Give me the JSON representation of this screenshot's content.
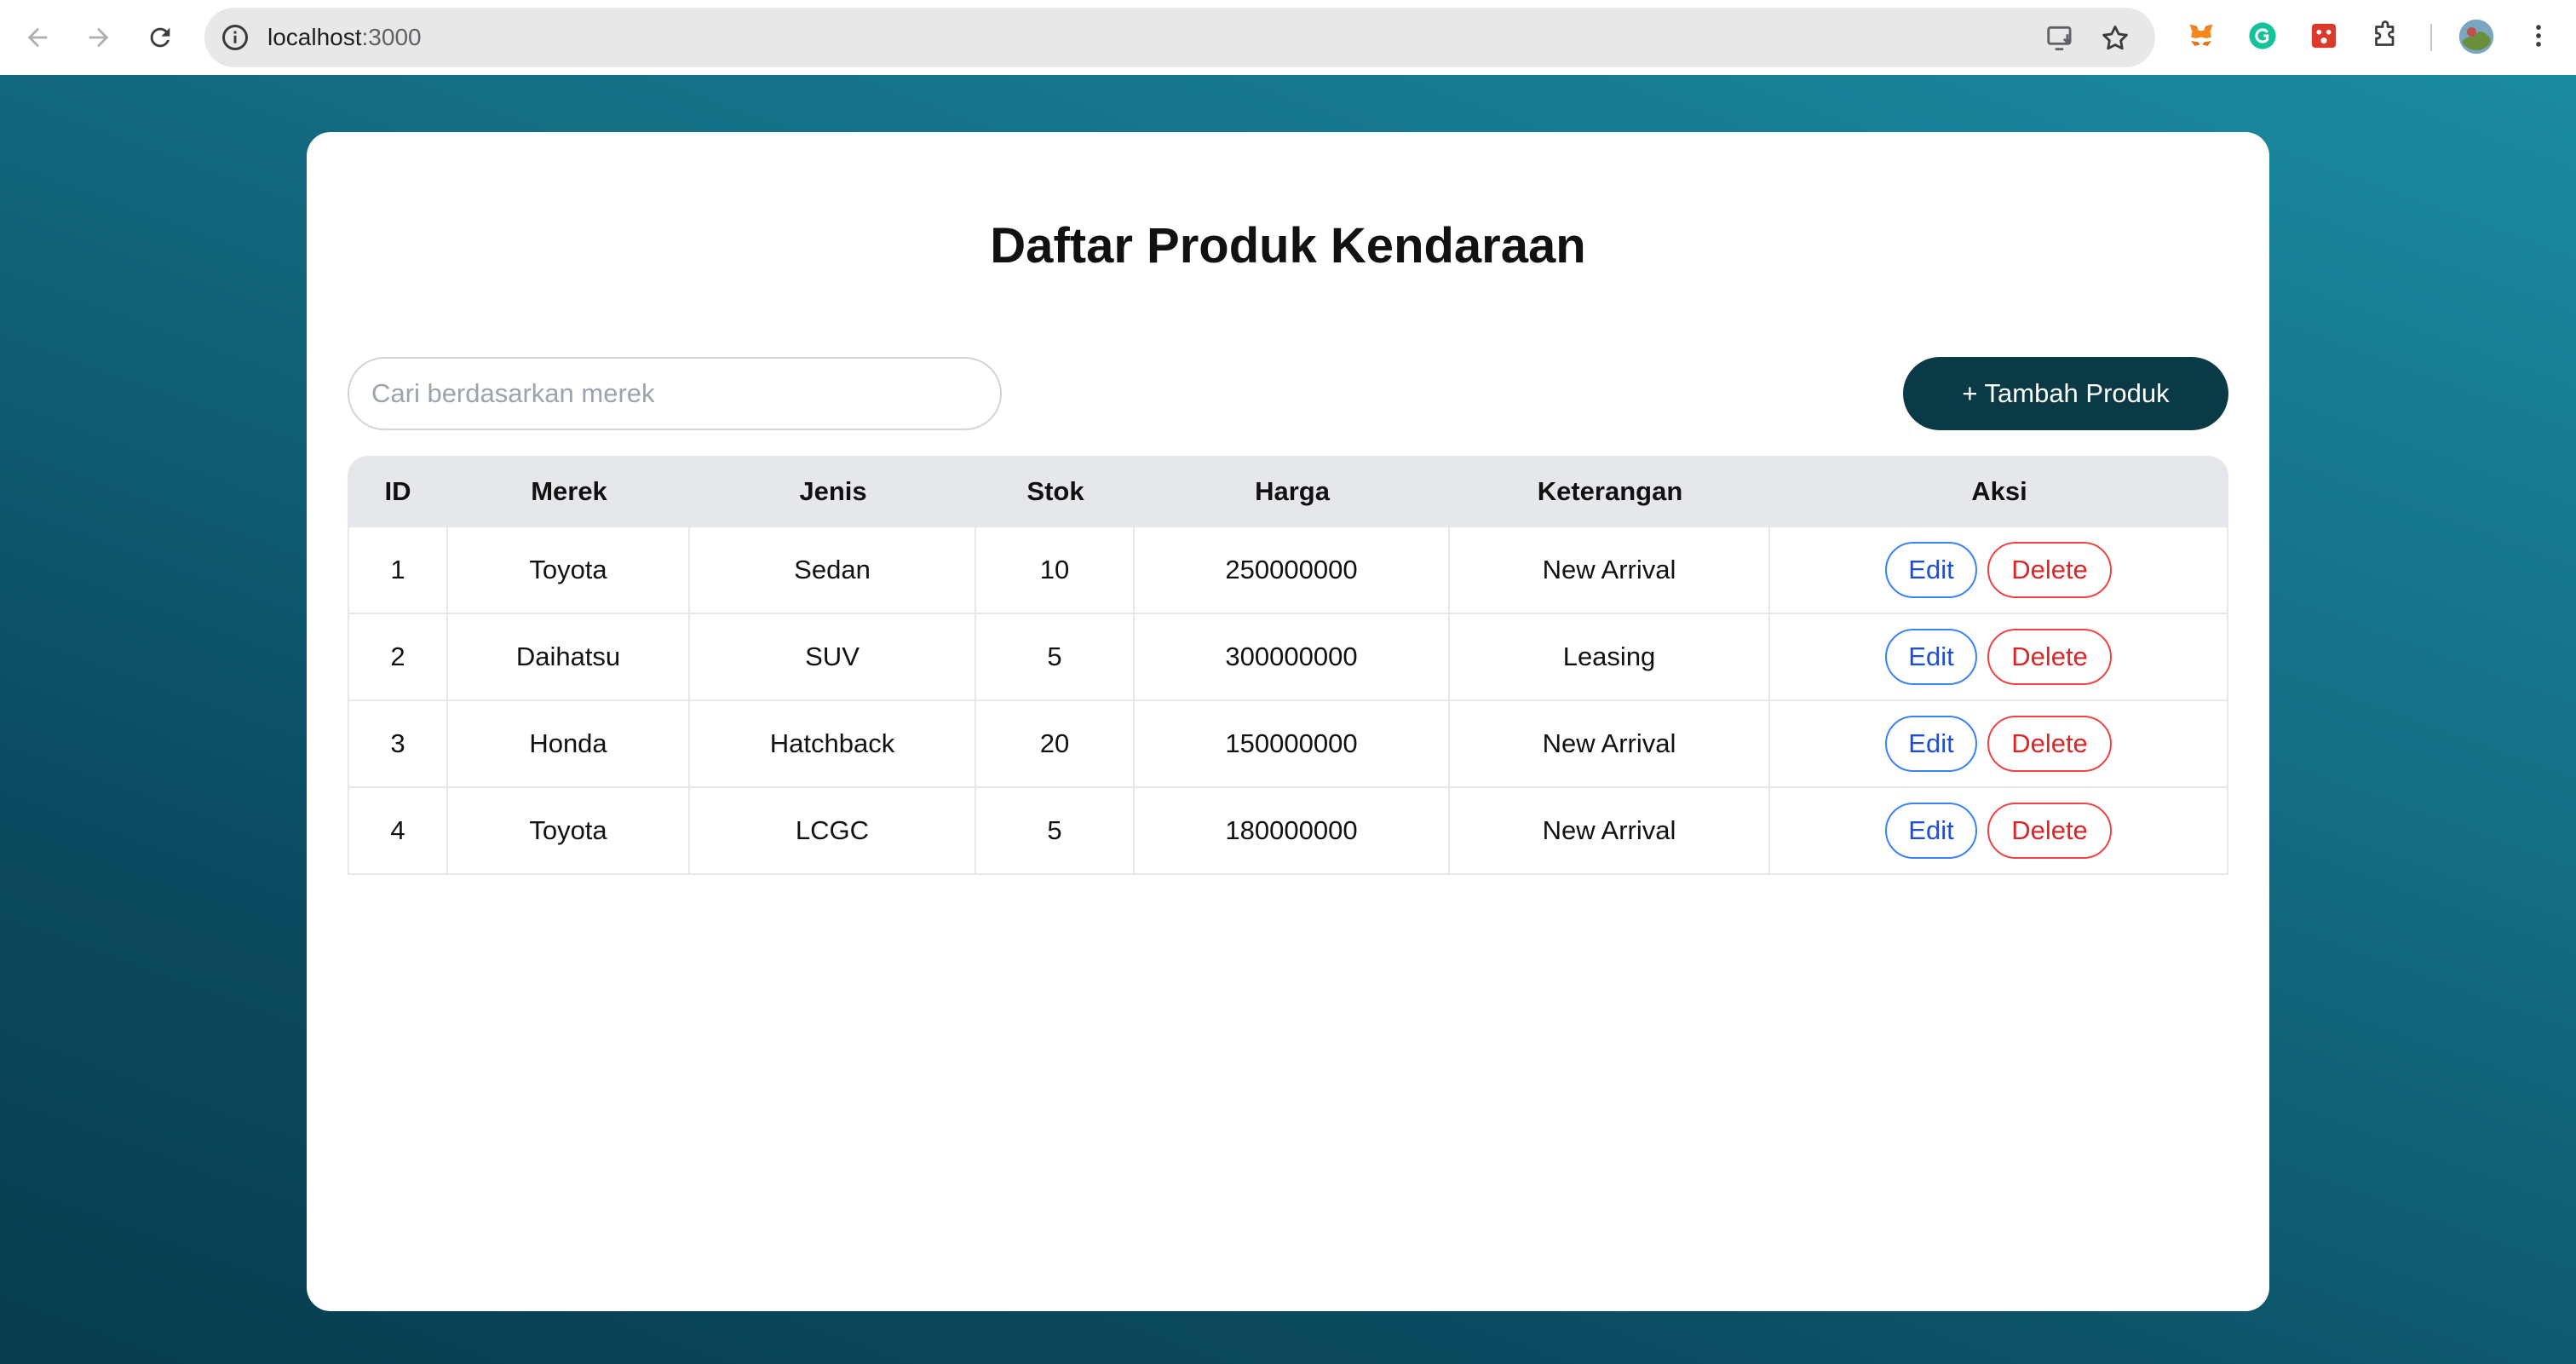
{
  "browser": {
    "url_host": "localhost",
    "url_port": ":3000"
  },
  "page": {
    "title": "Daftar Produk Kendaraan",
    "search": {
      "placeholder": "Cari berdasarkan merek",
      "value": ""
    },
    "add_button_label": "+ Tambah Produk",
    "table": {
      "headers": [
        "ID",
        "Merek",
        "Jenis",
        "Stok",
        "Harga",
        "Keterangan",
        "Aksi"
      ],
      "rows": [
        {
          "id": "1",
          "merek": "Toyota",
          "jenis": "Sedan",
          "stok": "10",
          "harga": "250000000",
          "keterangan": "New Arrival"
        },
        {
          "id": "2",
          "merek": "Daihatsu",
          "jenis": "SUV",
          "stok": "5",
          "harga": "300000000",
          "keterangan": "Leasing"
        },
        {
          "id": "3",
          "merek": "Honda",
          "jenis": "Hatchback",
          "stok": "20",
          "harga": "150000000",
          "keterangan": "New Arrival"
        },
        {
          "id": "4",
          "merek": "Toyota",
          "jenis": "LCGC",
          "stok": "5",
          "harga": "180000000",
          "keterangan": "New Arrival"
        }
      ],
      "edit_label": "Edit",
      "delete_label": "Delete"
    }
  },
  "colors": {
    "primary_button": "#0b3a47",
    "edit_accent": "#3b82f6",
    "delete_accent": "#ef4444",
    "header_bg": "#e5e7eb"
  },
  "icons": {
    "nav": [
      "back-arrow-icon",
      "forward-arrow-icon",
      "reload-icon"
    ],
    "omnibox": [
      "site-info-icon",
      "install-app-icon",
      "bookmark-star-icon"
    ],
    "extensions": [
      "metamask-fox-icon",
      "grammarly-icon",
      "red-extension-icon",
      "extensions-puzzle-icon",
      "profile-avatar-icon",
      "chrome-menu-icon"
    ]
  }
}
